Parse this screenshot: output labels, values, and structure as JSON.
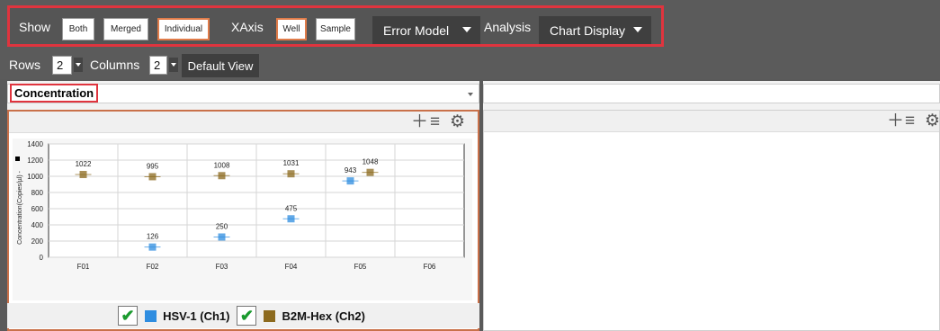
{
  "toolbar": {
    "show_label": "Show",
    "show_buttons": [
      "Both",
      "Merged",
      "Individual"
    ],
    "xaxis_label": "XAxis",
    "xaxis_buttons": [
      "Well",
      "Sample"
    ],
    "error_model_label": "Error Model",
    "analysis_label": "Analysis",
    "chart_display_label": "Chart Display",
    "accent_color": "#e0343e"
  },
  "layout_bar": {
    "rows_label": "Rows",
    "rows_value": "2",
    "columns_label": "Columns",
    "columns_value": "2",
    "default_view_label": "Default View"
  },
  "left_pane": {
    "selector_value": "Concentration",
    "icons": [
      "plus-icon",
      "list-icon",
      "gear-icon"
    ],
    "legend": [
      {
        "label": "HSV-1 (Ch1)",
        "color": "#2e8de0",
        "checked": true
      },
      {
        "label": "B2M-Hex (Ch2)",
        "color": "#8c6a1e",
        "checked": true
      }
    ]
  },
  "right_pane": {
    "selector_value": "",
    "icons": [
      "plus-icon",
      "list-icon",
      "gear-icon"
    ]
  },
  "chart_data": {
    "type": "scatter",
    "categories": [
      "F01",
      "F02",
      "F03",
      "F04",
      "F05",
      "F06"
    ],
    "ylabel": "Concentration(Copies/µl) -",
    "ylim": [
      0,
      1400
    ],
    "yticks": [
      0,
      200,
      400,
      600,
      800,
      1000,
      1200,
      1400
    ],
    "grid": true,
    "series": [
      {
        "name": "HSV-1 (Ch1)",
        "color": "#2e8de0",
        "points": [
          {
            "x": "F02",
            "y": 126,
            "label": "126"
          },
          {
            "x": "F03",
            "y": 250,
            "label": "250"
          },
          {
            "x": "F04",
            "y": 475,
            "label": "475"
          },
          {
            "x": "F05",
            "y": 943,
            "label": "943"
          }
        ]
      },
      {
        "name": "B2M-Hex (Ch2)",
        "color": "#8c6a1e",
        "points": [
          {
            "x": "F01",
            "y": 1022,
            "label": "1022"
          },
          {
            "x": "F02",
            "y": 995,
            "label": "995"
          },
          {
            "x": "F03",
            "y": 1008,
            "label": "1008"
          },
          {
            "x": "F04",
            "y": 1031,
            "label": "1031"
          },
          {
            "x": "F05",
            "y": 1048,
            "label": "1048"
          }
        ]
      }
    ]
  }
}
